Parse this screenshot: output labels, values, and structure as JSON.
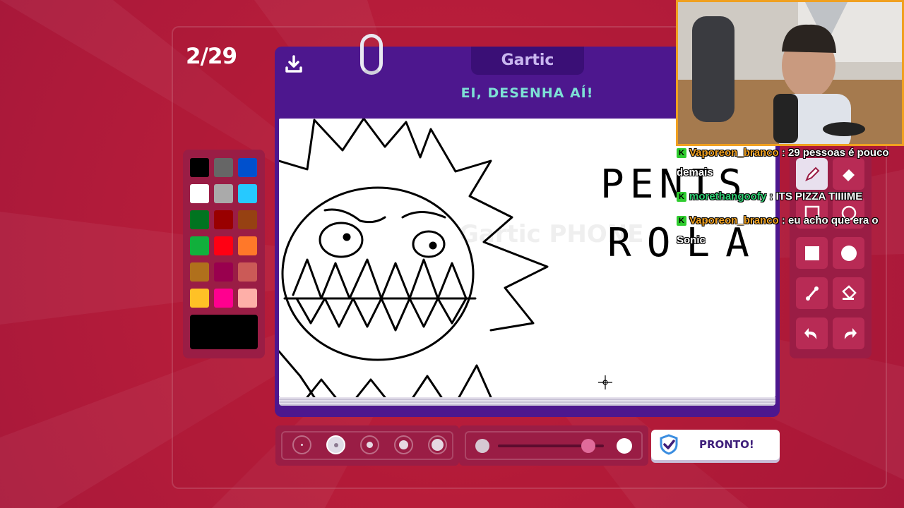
{
  "game": {
    "round_counter": "2/29",
    "brand": "Gartic",
    "prompt": "EI, DESENHA AÍ!",
    "ready_label": "PRONTO!"
  },
  "canvas": {
    "scribbled_text_line1": "PENIS E",
    "scribbled_text_line2": "ROLA",
    "watermark": "Gartic PHONE"
  },
  "palette": {
    "colors": [
      "#000000",
      "#666666",
      "#0050cd",
      "#ffffff",
      "#aaaaaa",
      "#26c9ff",
      "#017420",
      "#990000",
      "#964112",
      "#11b03c",
      "#ff0013",
      "#ff7829",
      "#b0701c",
      "#99004e",
      "#cb5a57",
      "#ffc126",
      "#ff008f",
      "#feafa8"
    ],
    "selected": "#000000"
  },
  "tools": [
    {
      "name": "pencil-tool",
      "icon": "pencil-icon",
      "active": true
    },
    {
      "name": "eraser-tool",
      "icon": "eraser-icon",
      "active": false
    },
    {
      "name": "rectangle-tool",
      "icon": "square-outline-icon",
      "active": false
    },
    {
      "name": "ellipse-tool",
      "icon": "circle-outline-icon",
      "active": false
    },
    {
      "name": "filled-rectangle-tool",
      "icon": "square-filled-icon",
      "active": false
    },
    {
      "name": "filled-ellipse-tool",
      "icon": "circle-filled-icon",
      "active": false
    },
    {
      "name": "line-tool",
      "icon": "line-icon",
      "active": false
    },
    {
      "name": "fill-tool",
      "icon": "bucket-icon",
      "active": false
    },
    {
      "name": "undo-button",
      "icon": "undo-icon",
      "active": false
    },
    {
      "name": "redo-button",
      "icon": "redo-icon",
      "active": false
    }
  ],
  "brush_sizes": {
    "count": 5,
    "selected_index": 1
  },
  "opacity": {
    "value": 0.85
  },
  "chat": [
    {
      "user": "Vaporeon_branco",
      "text": ": 29 pessoas é pouco demais",
      "user_color": "#f0a020"
    },
    {
      "user": "morethangoofy",
      "text": ": ITS PIZZA TIIIIME",
      "user_color": "#2ecc71"
    },
    {
      "user": "Vaporeon_branco",
      "text": ": eu acho que era o Sonic",
      "user_color": "#f0a020"
    }
  ],
  "chat_badge": "K"
}
